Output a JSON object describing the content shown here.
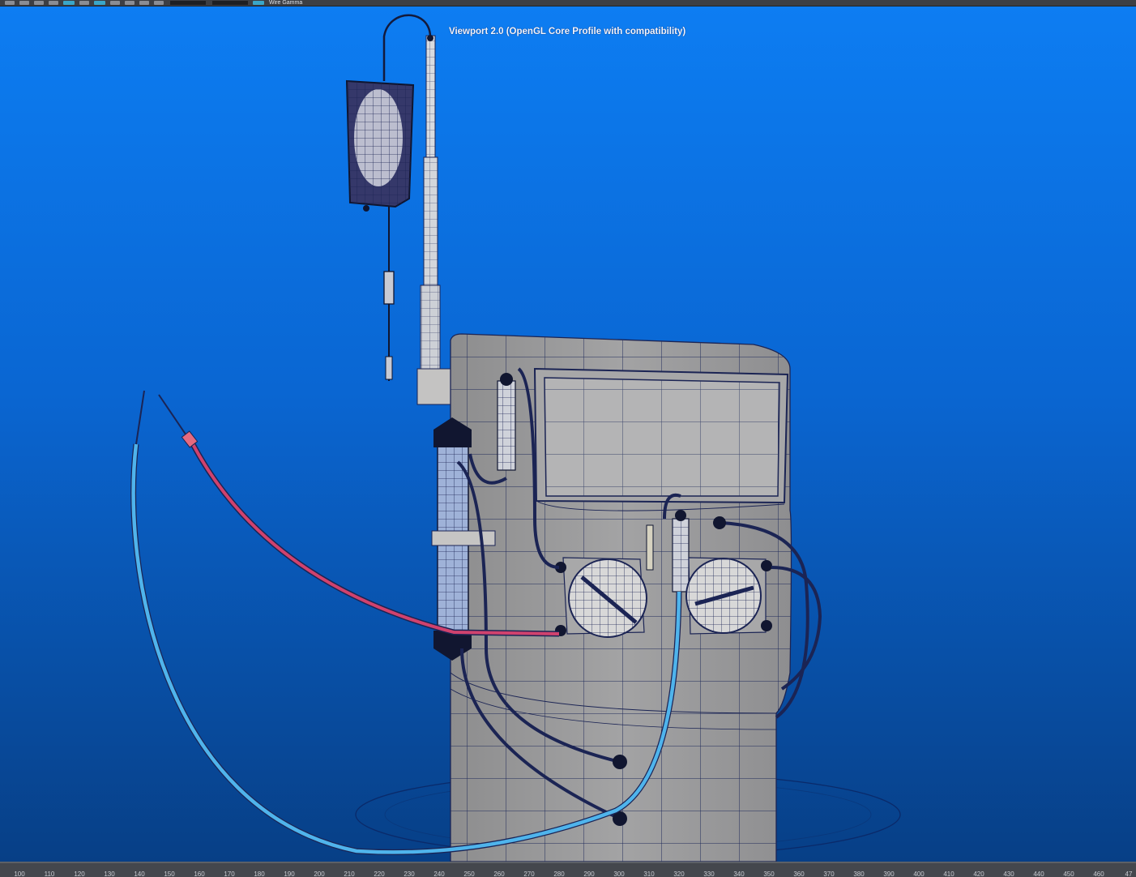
{
  "toolbar": {
    "camera_label": "Wire Gamma",
    "buttons": [
      "select-icon",
      "move-icon",
      "rotate-icon",
      "scale-icon",
      "camera-icon",
      "grid-icon",
      "wireframe-icon",
      "shaded-icon",
      "lights-icon",
      "texture-icon",
      "isolate-icon"
    ]
  },
  "viewport": {
    "title": "Viewport 2.0 (OpenGL Core Profile with compatibility)",
    "background_top": "#0d7df2",
    "background_bottom": "#073f86"
  },
  "timeline": {
    "ticks": [
      "100",
      "110",
      "120",
      "130",
      "140",
      "150",
      "160",
      "170",
      "180",
      "190",
      "200",
      "210",
      "220",
      "230",
      "240",
      "250",
      "260",
      "270",
      "280",
      "290",
      "300",
      "310",
      "320",
      "330",
      "340",
      "350",
      "360",
      "370",
      "380",
      "390",
      "400",
      "410",
      "420",
      "430",
      "440",
      "450",
      "460",
      "47"
    ]
  },
  "colors": {
    "machine_body": "#9e9e9f",
    "wireframe": "#1b2454",
    "blue_tube": "#4fb4ec",
    "red_tube": "#d0426e"
  }
}
